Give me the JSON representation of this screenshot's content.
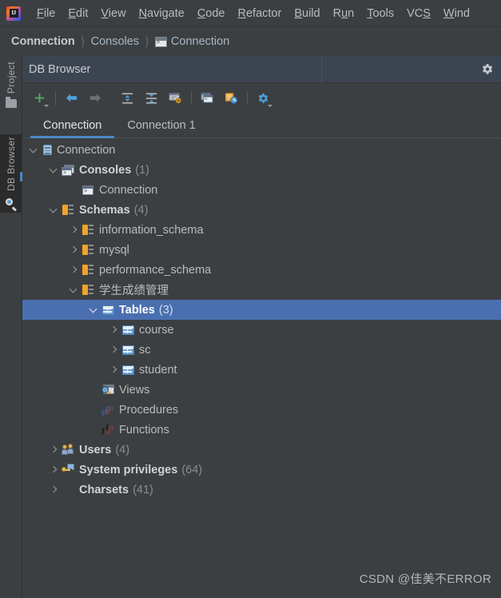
{
  "window": {
    "logo_text": "IJ"
  },
  "menubar": {
    "items": [
      {
        "label": "File",
        "mnemonic": "F"
      },
      {
        "label": "Edit",
        "mnemonic": "E"
      },
      {
        "label": "View",
        "mnemonic": "V"
      },
      {
        "label": "Navigate",
        "mnemonic": "N"
      },
      {
        "label": "Code",
        "mnemonic": "C"
      },
      {
        "label": "Refactor",
        "mnemonic": "R"
      },
      {
        "label": "Build",
        "mnemonic": "B"
      },
      {
        "label": "Run",
        "mnemonic": "u"
      },
      {
        "label": "Tools",
        "mnemonic": "T"
      },
      {
        "label": "VCS",
        "mnemonic": "S"
      },
      {
        "label": "Wind",
        "mnemonic": "W"
      }
    ]
  },
  "breadcrumb": {
    "items": [
      {
        "label": "Connection",
        "bold": true,
        "icon": null
      },
      {
        "label": "Consoles",
        "bold": false,
        "icon": null
      },
      {
        "label": "Connection",
        "bold": false,
        "icon": "console-icon"
      }
    ],
    "separator": "〉"
  },
  "toolsidebar": {
    "buttons": [
      {
        "label": "Project",
        "icon": "folder-icon",
        "active": false
      },
      {
        "label": "DB Browser",
        "icon": "db-magnifier-icon",
        "active": true
      }
    ]
  },
  "panel": {
    "title": "DB Browser",
    "settings_icon": "gear-icon",
    "toolbar": [
      {
        "name": "add-button",
        "icon": "plus-icon",
        "has_dropdown": true
      },
      {
        "name": "back-button",
        "icon": "arrow-left-icon",
        "has_dropdown": false
      },
      {
        "name": "forward-button",
        "icon": "arrow-right-icon",
        "has_dropdown": false
      },
      {
        "name": "expand-all-button",
        "icon": "expand-all-icon",
        "has_dropdown": false
      },
      {
        "name": "collapse-all-button",
        "icon": "collapse-all-icon",
        "has_dropdown": false
      },
      {
        "name": "properties-button",
        "icon": "properties-icon",
        "has_dropdown": false
      },
      {
        "name": "open-console-button",
        "icon": "console-window-icon",
        "has_dropdown": false
      },
      {
        "name": "history-button",
        "icon": "database-clock-icon",
        "has_dropdown": false
      },
      {
        "name": "settings-button",
        "icon": "gear-icon",
        "has_dropdown": true
      }
    ],
    "tabs": [
      {
        "label": "Connection",
        "active": true
      },
      {
        "label": "Connection 1",
        "active": false
      }
    ]
  },
  "tree": {
    "rows": [
      {
        "indent": 0,
        "arrow": "down",
        "icon": "database-icon",
        "label": "Connection",
        "bold": false,
        "count": "",
        "selected": false
      },
      {
        "indent": 1,
        "arrow": "down",
        "icon": "consoles-icon",
        "label": "Consoles",
        "bold": true,
        "count": "(1)",
        "selected": false
      },
      {
        "indent": 2,
        "arrow": "none",
        "icon": "console-icon",
        "label": "Connection",
        "bold": false,
        "count": "",
        "selected": false
      },
      {
        "indent": 1,
        "arrow": "down",
        "icon": "schemas-icon",
        "label": "Schemas",
        "bold": true,
        "count": "(4)",
        "selected": false
      },
      {
        "indent": 2,
        "arrow": "right",
        "icon": "schema-icon",
        "label": "information_schema",
        "bold": false,
        "count": "",
        "selected": false
      },
      {
        "indent": 2,
        "arrow": "right",
        "icon": "schema-icon",
        "label": "mysql",
        "bold": false,
        "count": "",
        "selected": false
      },
      {
        "indent": 2,
        "arrow": "right",
        "icon": "schema-icon",
        "label": "performance_schema",
        "bold": false,
        "count": "",
        "selected": false
      },
      {
        "indent": 2,
        "arrow": "down",
        "icon": "schema-icon",
        "label": "学生成绩管理",
        "bold": false,
        "count": "",
        "selected": false
      },
      {
        "indent": 3,
        "arrow": "down",
        "icon": "table-group-icon",
        "label": "Tables",
        "bold": true,
        "count": "(3)",
        "selected": true
      },
      {
        "indent": 4,
        "arrow": "right",
        "icon": "table-icon",
        "label": "course",
        "bold": false,
        "count": "",
        "selected": false
      },
      {
        "indent": 4,
        "arrow": "right",
        "icon": "table-icon",
        "label": "sc",
        "bold": false,
        "count": "",
        "selected": false
      },
      {
        "indent": 4,
        "arrow": "right",
        "icon": "table-icon",
        "label": "student",
        "bold": false,
        "count": "",
        "selected": false
      },
      {
        "indent": 3,
        "arrow": "none",
        "icon": "views-icon",
        "label": "Views",
        "bold": false,
        "count": "",
        "selected": false
      },
      {
        "indent": 3,
        "arrow": "none",
        "icon": "procedures-icon",
        "label": "Procedures",
        "bold": false,
        "count": "",
        "selected": false
      },
      {
        "indent": 3,
        "arrow": "none",
        "icon": "functions-icon",
        "label": "Functions",
        "bold": false,
        "count": "",
        "selected": false
      },
      {
        "indent": 1,
        "arrow": "right",
        "icon": "users-icon",
        "label": "Users",
        "bold": true,
        "count": "(4)",
        "selected": false
      },
      {
        "indent": 1,
        "arrow": "right",
        "icon": "privileges-icon",
        "label": "System privileges",
        "bold": true,
        "count": "(64)",
        "selected": false
      },
      {
        "indent": 1,
        "arrow": "right",
        "icon": "none",
        "label": "Charsets",
        "bold": true,
        "count": "(41)",
        "selected": false
      }
    ]
  },
  "watermark": {
    "text": "CSDN @佳美不ERROR"
  },
  "colors": {
    "background": "#3c3f41",
    "panel_header": "#3c4450",
    "selection": "#4a6fb0",
    "accent": "#4a88c7",
    "text": "#bbbbbb",
    "text_muted": "#8c8c8c"
  }
}
